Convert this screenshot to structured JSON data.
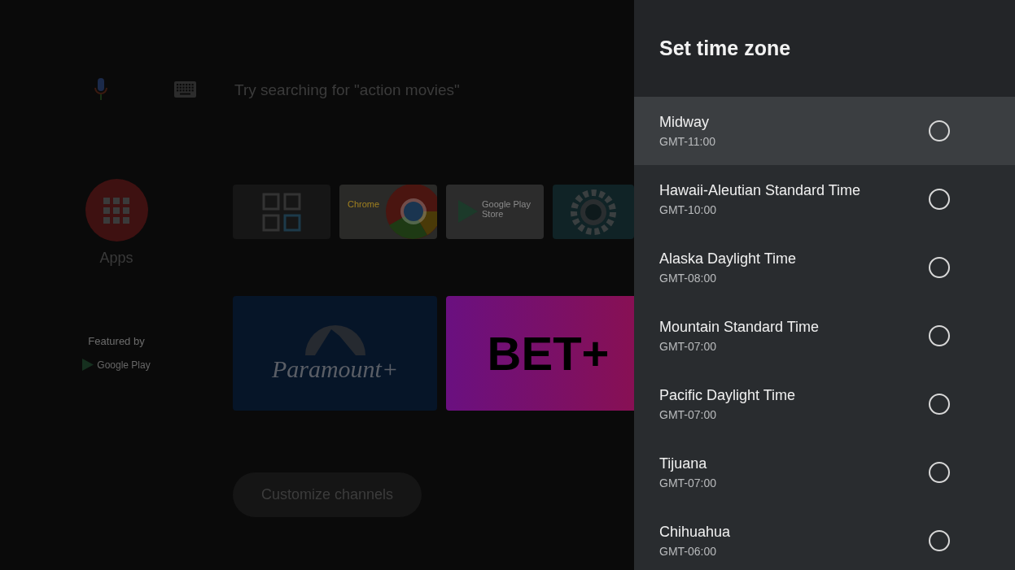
{
  "home": {
    "search": {
      "placeholder": "Try searching for \"action movies\""
    },
    "apps_label": "Apps",
    "featured": {
      "label": "Featured by",
      "store": "Google Play"
    },
    "app_tiles": [
      {
        "kind": "grid"
      },
      {
        "kind": "chrome",
        "label": "Chrome"
      },
      {
        "kind": "play",
        "label": "Google Play Store"
      },
      {
        "kind": "settings"
      }
    ],
    "featured_tiles": [
      {
        "kind": "paramount",
        "label": "Paramount+"
      },
      {
        "kind": "bet",
        "label": "BET+"
      }
    ],
    "customize_button": "Customize channels"
  },
  "panel": {
    "title": "Set time zone",
    "zones": [
      {
        "name": "Midway",
        "offset": "GMT-11:00",
        "focused": true,
        "selected": false
      },
      {
        "name": "Hawaii-Aleutian Standard Time",
        "offset": "GMT-10:00",
        "focused": false,
        "selected": false
      },
      {
        "name": "Alaska Daylight Time",
        "offset": "GMT-08:00",
        "focused": false,
        "selected": false
      },
      {
        "name": "Mountain Standard Time",
        "offset": "GMT-07:00",
        "focused": false,
        "selected": false
      },
      {
        "name": "Pacific Daylight Time",
        "offset": "GMT-07:00",
        "focused": false,
        "selected": false
      },
      {
        "name": "Tijuana",
        "offset": "GMT-07:00",
        "focused": false,
        "selected": false
      },
      {
        "name": "Chihuahua",
        "offset": "GMT-06:00",
        "focused": false,
        "selected": false
      }
    ]
  }
}
